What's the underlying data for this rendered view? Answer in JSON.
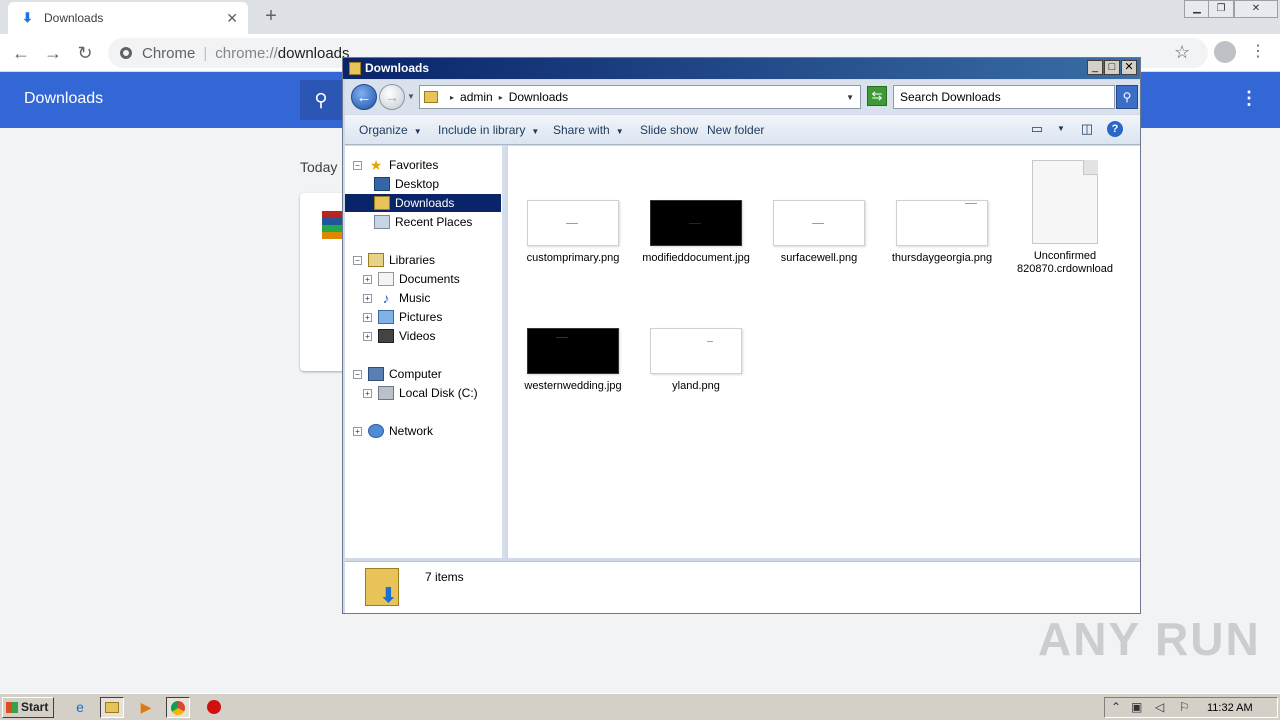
{
  "chrome": {
    "tab_title": "Downloads",
    "site_name": "Chrome",
    "url_scheme": "chrome://",
    "url_path": "downloads",
    "page_title": "Downloads",
    "date_heading": "Today"
  },
  "explorer": {
    "title": "Downloads",
    "breadcrumb": [
      "admin",
      "Downloads"
    ],
    "search_placeholder": "Search Downloads",
    "commands": {
      "organize": "Organize",
      "include_in_library": "Include in library",
      "share_with": "Share with",
      "slide_show": "Slide show",
      "new_folder": "New folder"
    },
    "nav": {
      "favorites": "Favorites",
      "desktop": "Desktop",
      "downloads": "Downloads",
      "recent_places": "Recent Places",
      "libraries": "Libraries",
      "documents": "Documents",
      "music": "Music",
      "pictures": "Pictures",
      "videos": "Videos",
      "computer": "Computer",
      "local_disk": "Local Disk (C:)",
      "network": "Network"
    },
    "files": [
      {
        "name": "customprimary.png",
        "thumb": "light"
      },
      {
        "name": "modifieddocument.jpg",
        "thumb": "dark"
      },
      {
        "name": "surfacewell.png",
        "thumb": "light"
      },
      {
        "name": "thursdaygeorgia.png",
        "thumb": "light"
      },
      {
        "name": "Unconfirmed 820870.crdownload",
        "thumb": "document"
      },
      {
        "name": "westernwedding.jpg",
        "thumb": "dark"
      },
      {
        "name": "yland.png",
        "thumb": "light"
      }
    ],
    "status": "7 items"
  },
  "taskbar": {
    "start_label": "Start",
    "clock": "11:32 AM"
  },
  "watermark": "ANY RUN",
  "colors": {
    "chrome_header": "#3367d6",
    "selection": "#0a246a",
    "titlebar": "#0a246a"
  }
}
